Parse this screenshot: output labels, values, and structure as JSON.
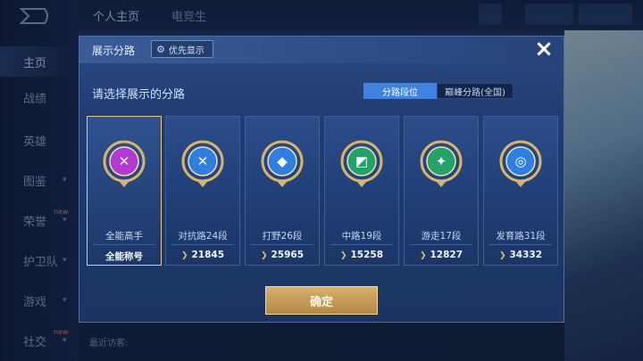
{
  "background": {
    "sidebar_items": [
      {
        "label": "主页",
        "active": true
      },
      {
        "label": "战绩"
      },
      {
        "label": "英雄"
      },
      {
        "label": "图鉴",
        "chevron": true
      },
      {
        "label": "荣誉",
        "chevron": true,
        "new": "new"
      },
      {
        "label": "护卫队",
        "chevron": true
      },
      {
        "label": "游戏",
        "chevron": true
      },
      {
        "label": "社交",
        "chevron": true,
        "new": "new"
      }
    ],
    "top_tabs": [
      "个人主页",
      "电竞生"
    ],
    "recent_visitors": "最近访客:"
  },
  "modal": {
    "title": "展示分路",
    "priority_label": "优先显示",
    "close_icon": "×",
    "subtitle": "请选择展示的分路",
    "segments": [
      {
        "label": "分路段位",
        "active": true
      },
      {
        "label": "巅峰分路(全国)",
        "active": false
      }
    ],
    "cards": [
      {
        "name": "全能高手",
        "stat": "全能称号",
        "icon": "all-round-emblem-icon",
        "color": "#b23ad0",
        "selected": true
      },
      {
        "name": "对抗路24段",
        "stat": "21845",
        "icon": "clash-lane-emblem-icon",
        "color": "#2f7fe0",
        "selected": false
      },
      {
        "name": "打野26段",
        "stat": "25965",
        "icon": "jungle-emblem-icon",
        "color": "#2f7fe0",
        "selected": false
      },
      {
        "name": "中路19段",
        "stat": "15258",
        "icon": "mid-lane-emblem-icon",
        "color": "#21a36a",
        "selected": false
      },
      {
        "name": "游走17段",
        "stat": "12827",
        "icon": "roam-emblem-icon",
        "color": "#21a36a",
        "selected": false
      },
      {
        "name": "发育路31段",
        "stat": "34332",
        "icon": "farm-lane-emblem-icon",
        "color": "#2f7fe0",
        "selected": false
      }
    ],
    "confirm_label": "确定"
  },
  "colors": {
    "accent": "#3f82e0",
    "gold": "#d6b06d"
  }
}
